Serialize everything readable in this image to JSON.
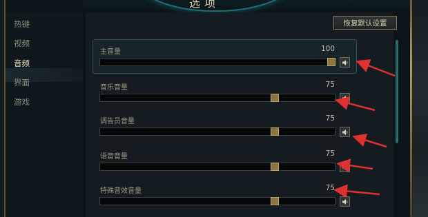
{
  "window": {
    "title": "选项"
  },
  "sidebar": {
    "items": [
      {
        "label": "热键",
        "active": false
      },
      {
        "label": "视频",
        "active": false
      },
      {
        "label": "音频",
        "active": true
      },
      {
        "label": "界面",
        "active": false
      },
      {
        "label": "游戏",
        "active": false
      }
    ]
  },
  "toolbar": {
    "reset_label": "恢复默认设置"
  },
  "audio": {
    "sliders": [
      {
        "label": "主音量",
        "value": "100",
        "level": 1.0,
        "mute_icon": "speaker-icon"
      },
      {
        "label": "音乐音量",
        "value": "75",
        "level": 0.75,
        "mute_icon": "speaker-icon"
      },
      {
        "label": "调告员音量",
        "value": "75",
        "level": 0.75,
        "mute_icon": "speaker-icon"
      },
      {
        "label": "语音音量",
        "value": "75",
        "level": 0.75,
        "mute_icon": "speaker-icon"
      },
      {
        "label": "特殊音效音量",
        "value": "75",
        "level": 0.75,
        "mute_icon": "speaker-icon"
      }
    ]
  },
  "colors": {
    "accent_gold": "#8a7545",
    "annotation_red": "#e03030",
    "frame_teal": "#2f5156"
  }
}
